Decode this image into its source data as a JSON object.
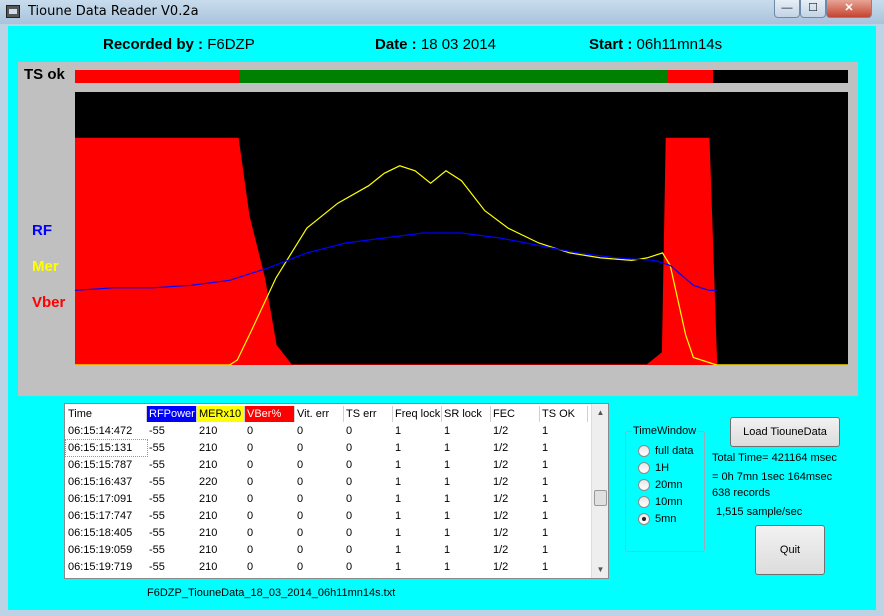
{
  "window": {
    "title": "Tioune Data Reader V0.2a",
    "min_glyph": "—",
    "max_glyph": "☐",
    "close_glyph": "✕"
  },
  "header": {
    "recorded_label": "Recorded by :",
    "recorded_value": "F6DZP",
    "date_label": "Date :",
    "date_value": "18 03 2014",
    "start_label": "Start :",
    "start_value": "06h11mn14s"
  },
  "ts_ok": {
    "label": "TS ok",
    "segments": [
      {
        "state": "bad",
        "start": 0.0,
        "end": 0.212
      },
      {
        "state": "ok",
        "start": 0.212,
        "end": 0.766
      },
      {
        "state": "bad",
        "start": 0.766,
        "end": 0.825
      },
      {
        "state": "none",
        "start": 0.825,
        "end": 1.0
      }
    ]
  },
  "legend": {
    "rf": "RF",
    "mer": "Mer",
    "vber": "Vber"
  },
  "colors": {
    "rf": "#0000ff",
    "mer": "#ffff00",
    "vber": "#ff0000",
    "ok": "#008000",
    "bad": "#ff0000",
    "panel": "#00ffff"
  },
  "chart_data": {
    "type": "line",
    "x_domain": [
      0,
      1
    ],
    "y_domain": [
      0,
      1
    ],
    "series": [
      {
        "name": "RF",
        "x": [
          0.0,
          0.05,
          0.1,
          0.15,
          0.2,
          0.25,
          0.3,
          0.35,
          0.4,
          0.45,
          0.5,
          0.55,
          0.6,
          0.65,
          0.7,
          0.75,
          0.77,
          0.8,
          0.82,
          0.83
        ],
        "values": [
          0.3,
          0.31,
          0.31,
          0.32,
          0.34,
          0.39,
          0.45,
          0.49,
          0.51,
          0.53,
          0.53,
          0.51,
          0.48,
          0.45,
          0.43,
          0.42,
          0.4,
          0.32,
          0.3,
          0.3
        ]
      },
      {
        "name": "Mer",
        "x": [
          0.0,
          0.2,
          0.21,
          0.23,
          0.26,
          0.3,
          0.34,
          0.38,
          0.4,
          0.42,
          0.44,
          0.46,
          0.48,
          0.5,
          0.53,
          0.56,
          0.6,
          0.64,
          0.68,
          0.72,
          0.74,
          0.76,
          0.77,
          0.79,
          0.8,
          0.83,
          1.0
        ],
        "values": [
          0.0,
          0.0,
          0.02,
          0.15,
          0.35,
          0.55,
          0.65,
          0.72,
          0.77,
          0.8,
          0.78,
          0.73,
          0.78,
          0.74,
          0.62,
          0.55,
          0.49,
          0.45,
          0.43,
          0.42,
          0.43,
          0.45,
          0.4,
          0.12,
          0.03,
          0.0,
          0.0
        ]
      },
      {
        "name": "Vber",
        "x": [
          0.0,
          0.211,
          0.225,
          0.245,
          0.26,
          0.28,
          0.74,
          0.76,
          0.765,
          0.82,
          0.83,
          1.0
        ],
        "values": [
          0.91,
          0.91,
          0.6,
          0.35,
          0.08,
          0.0,
          0.0,
          0.05,
          0.91,
          0.91,
          0.0,
          0.0
        ]
      }
    ]
  },
  "table": {
    "columns": [
      "Time",
      "RFPower",
      "MERx10",
      "VBer%",
      "Vit. err",
      "TS err",
      "Freq lock",
      "SR lock",
      "FEC",
      "TS OK"
    ],
    "rows": [
      [
        "06:15:14:472",
        "-55",
        "210",
        "0",
        "0",
        "0",
        "1",
        "1",
        "1/2",
        "1"
      ],
      [
        "06:15:15:131",
        "-55",
        "210",
        "0",
        "0",
        "0",
        "1",
        "1",
        "1/2",
        "1"
      ],
      [
        "06:15:15:787",
        "-55",
        "210",
        "0",
        "0",
        "0",
        "1",
        "1",
        "1/2",
        "1"
      ],
      [
        "06:15:16:437",
        "-55",
        "220",
        "0",
        "0",
        "0",
        "1",
        "1",
        "1/2",
        "1"
      ],
      [
        "06:15:17:091",
        "-55",
        "210",
        "0",
        "0",
        "0",
        "1",
        "1",
        "1/2",
        "1"
      ],
      [
        "06:15:17:747",
        "-55",
        "210",
        "0",
        "0",
        "0",
        "1",
        "1",
        "1/2",
        "1"
      ],
      [
        "06:15:18:405",
        "-55",
        "210",
        "0",
        "0",
        "0",
        "1",
        "1",
        "1/2",
        "1"
      ],
      [
        "06:15:19:059",
        "-55",
        "210",
        "0",
        "0",
        "0",
        "1",
        "1",
        "1/2",
        "1"
      ],
      [
        "06:15:19:719",
        "-55",
        "210",
        "0",
        "0",
        "0",
        "1",
        "1",
        "1/2",
        "1"
      ]
    ],
    "selected_row": 1
  },
  "filename": "F6DZP_TiouneData_18_03_2014_06h11mn14s.txt",
  "time_window": {
    "title": "TimeWindow",
    "options": [
      "full data",
      "1H",
      "20mn",
      "10mn",
      "5mn"
    ],
    "selected": "5mn"
  },
  "buttons": {
    "load": "Load TiouneData",
    "quit": "Quit"
  },
  "info": {
    "total_time": "Total Time= 421164 msec",
    "duration": "= 0h 7mn 1sec 164msec",
    "records": "638 records",
    "rate": "1,515 sample/sec"
  }
}
